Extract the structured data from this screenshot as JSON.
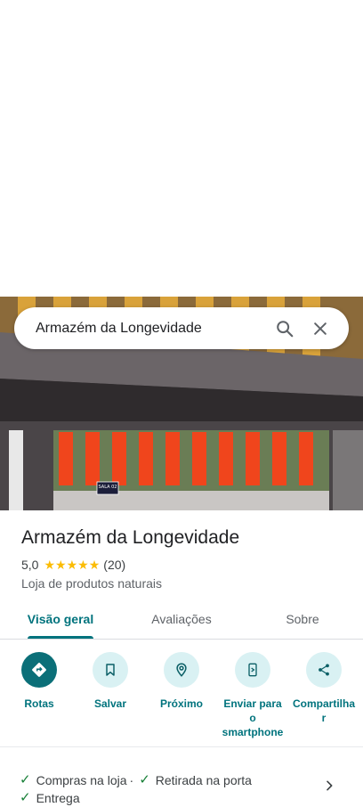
{
  "search": {
    "query": "Armazém da Longevidade"
  },
  "photo": {
    "sign_text": "SALA 02"
  },
  "place": {
    "title": "Armazém da Longevidade",
    "rating": "5,0",
    "stars": 5,
    "review_count": "(20)",
    "category": "Loja de produtos naturais"
  },
  "tabs": [
    {
      "label": "Visão geral",
      "active": true
    },
    {
      "label": "Avaliações",
      "active": false
    },
    {
      "label": "Sobre",
      "active": false
    }
  ],
  "actions": [
    {
      "label": "Rotas",
      "icon": "directions-icon"
    },
    {
      "label": "Salvar",
      "icon": "bookmark-icon"
    },
    {
      "label": "Próximo",
      "icon": "nearby-icon"
    },
    {
      "label": "Enviar para o smartphone",
      "icon": "send-to-phone-icon"
    },
    {
      "label": "Compartilhar",
      "icon": "share-icon"
    }
  ],
  "features": {
    "item1": "Compras na loja",
    "separator": "·",
    "item2": "Retirada na porta",
    "item3": "Entrega"
  },
  "colors": {
    "accent": "#00737d",
    "check": "#188038",
    "star": "#fbbc04"
  }
}
